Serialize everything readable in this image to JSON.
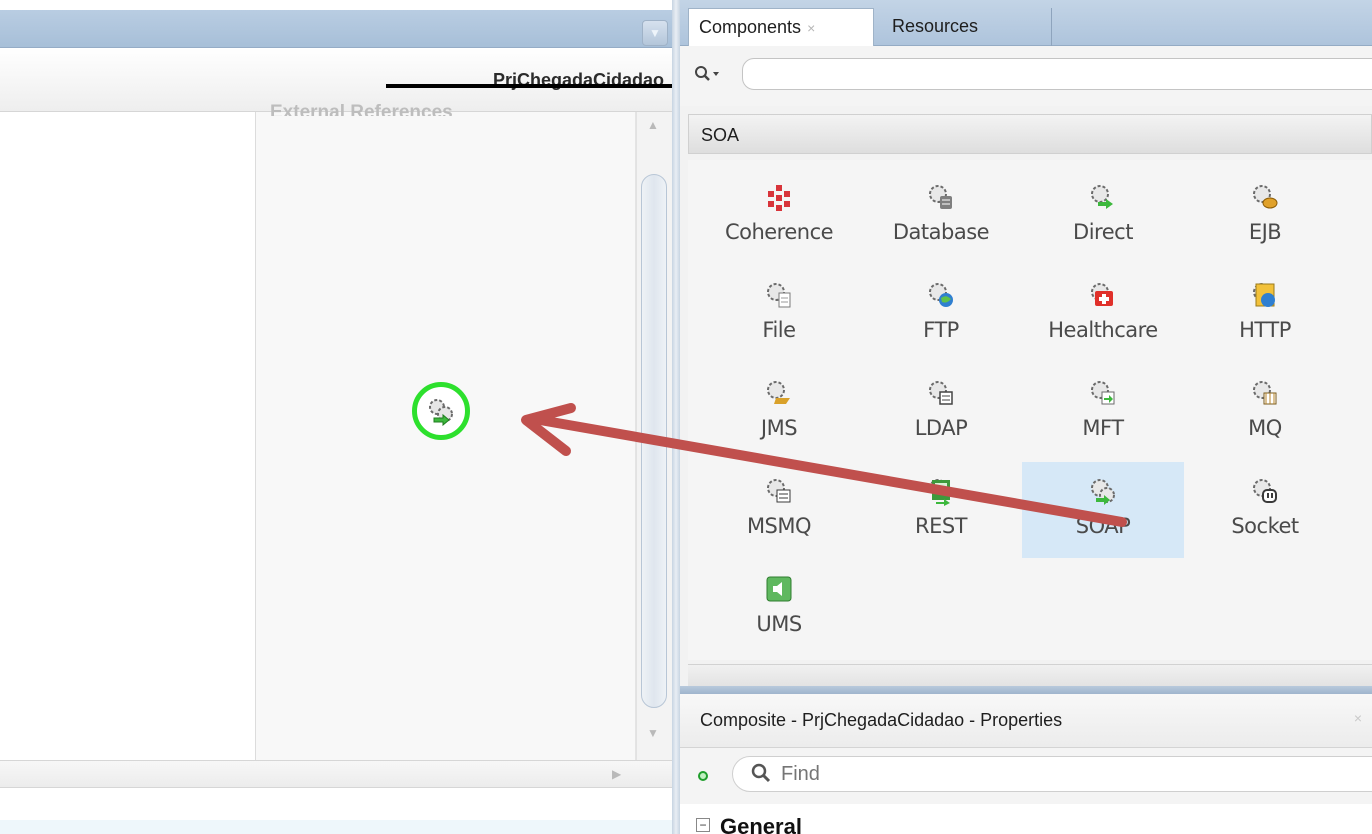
{
  "editor": {
    "composite_title": "PrjChegadaCidadao",
    "references_lane_title": "External References",
    "dropped_component": "SOAP"
  },
  "palette": {
    "tabs": [
      {
        "label": "Components",
        "active": true
      },
      {
        "label": "Resources",
        "active": false
      }
    ],
    "search": {
      "value": "",
      "placeholder": ""
    },
    "category": "SOA",
    "items": [
      {
        "label": "Coherence",
        "icon": "coherence-icon"
      },
      {
        "label": "Database",
        "icon": "database-adapter-icon"
      },
      {
        "label": "Direct",
        "icon": "direct-adapter-icon"
      },
      {
        "label": "EJB",
        "icon": "ejb-adapter-icon"
      },
      {
        "label": "File",
        "icon": "file-adapter-icon"
      },
      {
        "label": "FTP",
        "icon": "ftp-adapter-icon"
      },
      {
        "label": "Healthcare",
        "icon": "healthcare-adapter-icon"
      },
      {
        "label": "HTTP",
        "icon": "http-adapter-icon"
      },
      {
        "label": "JMS",
        "icon": "jms-adapter-icon"
      },
      {
        "label": "LDAP",
        "icon": "ldap-adapter-icon"
      },
      {
        "label": "MFT",
        "icon": "mft-adapter-icon"
      },
      {
        "label": "MQ",
        "icon": "mq-adapter-icon"
      },
      {
        "label": "MSMQ",
        "icon": "msmq-adapter-icon"
      },
      {
        "label": "REST",
        "icon": "rest-adapter-icon"
      },
      {
        "label": "SOAP",
        "icon": "soap-adapter-icon",
        "selected": true
      },
      {
        "label": "Socket",
        "icon": "socket-adapter-icon"
      },
      {
        "label": "UMS",
        "icon": "ums-adapter-icon"
      }
    ]
  },
  "properties": {
    "title": "Composite - PrjChegadaCidadao - Properties",
    "find_placeholder": "Find",
    "section": "General"
  },
  "colors": {
    "drop_target_ring": "#2de02d",
    "arrow": "#c0504d",
    "selected_item": "#d6e8f7"
  }
}
